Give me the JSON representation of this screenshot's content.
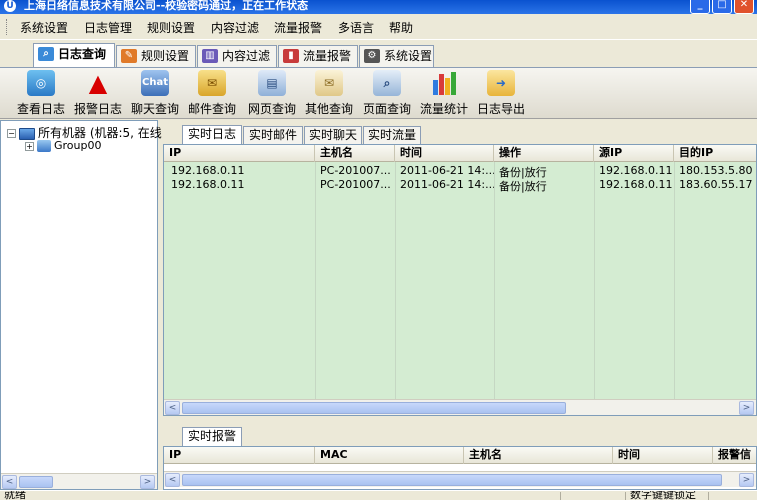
{
  "window": {
    "title": "上海日络信息技术有限公司--校验密码通过，正在工作状态",
    "controls": {
      "minimize": "_",
      "maximize": "□",
      "close": "✕"
    }
  },
  "menu": [
    "系统设置",
    "日志管理",
    "规则设置",
    "内容过滤",
    "流量报警",
    "多语言",
    "帮助"
  ],
  "main_tabs": [
    {
      "label": "日志查询",
      "icon": "magnifier-icon",
      "active": true
    },
    {
      "label": "规则设置",
      "icon": "wrench-icon"
    },
    {
      "label": "内容过滤",
      "icon": "books-icon"
    },
    {
      "label": "流量报警",
      "icon": "chart-icon"
    },
    {
      "label": "系统设置",
      "icon": "gear-icon"
    }
  ],
  "toolbar": [
    {
      "label": "查看日志",
      "icon": "log-view-icon"
    },
    {
      "label": "报警日志",
      "icon": "warning-icon"
    },
    {
      "label": "聊天查询",
      "icon": "chat-icon",
      "glyph": "Chat"
    },
    {
      "label": "邮件查询",
      "icon": "mail-icon"
    },
    {
      "label": "网页查询",
      "icon": "webpage-icon"
    },
    {
      "label": "其他查询",
      "icon": "envelope-icon"
    },
    {
      "label": "页面查询",
      "icon": "page-search-icon"
    },
    {
      "label": "流量统计",
      "icon": "bar-chart-icon"
    },
    {
      "label": "日志导出",
      "icon": "export-icon"
    }
  ],
  "tree": {
    "root": "所有机器 (机器:5, 在线",
    "root_expander": "−",
    "child": "Group00",
    "child_expander": "+"
  },
  "log_tabs": [
    "实时日志",
    "实时邮件",
    "实时聊天",
    "实时流量"
  ],
  "log_table": {
    "columns": [
      "IP",
      "主机名",
      "时间",
      "操作",
      "源IP",
      "目的IP"
    ],
    "rows": [
      [
        "192.168.0.11",
        "PC-201007...",
        "2011-06-21 14:...",
        "备份|放行",
        "192.168.0.11",
        "180.153.5.80"
      ],
      [
        "192.168.0.11",
        "PC-201007...",
        "2011-06-21 14:...",
        "备份|放行",
        "192.168.0.11",
        "183.60.55.17"
      ]
    ]
  },
  "alarm_tabs": [
    "实时报警"
  ],
  "alarm_table": {
    "columns": [
      "IP",
      "MAC",
      "主机名",
      "时间",
      "报警信"
    ]
  },
  "scroll": {
    "left": "<",
    "right": ">"
  },
  "status": {
    "left": "就绪",
    "right": "数字键键锁定"
  },
  "colors": {
    "grid_bg": "#d4ecd2",
    "title_bar": "#0a52cf",
    "window_bg": "#ece9d8"
  }
}
